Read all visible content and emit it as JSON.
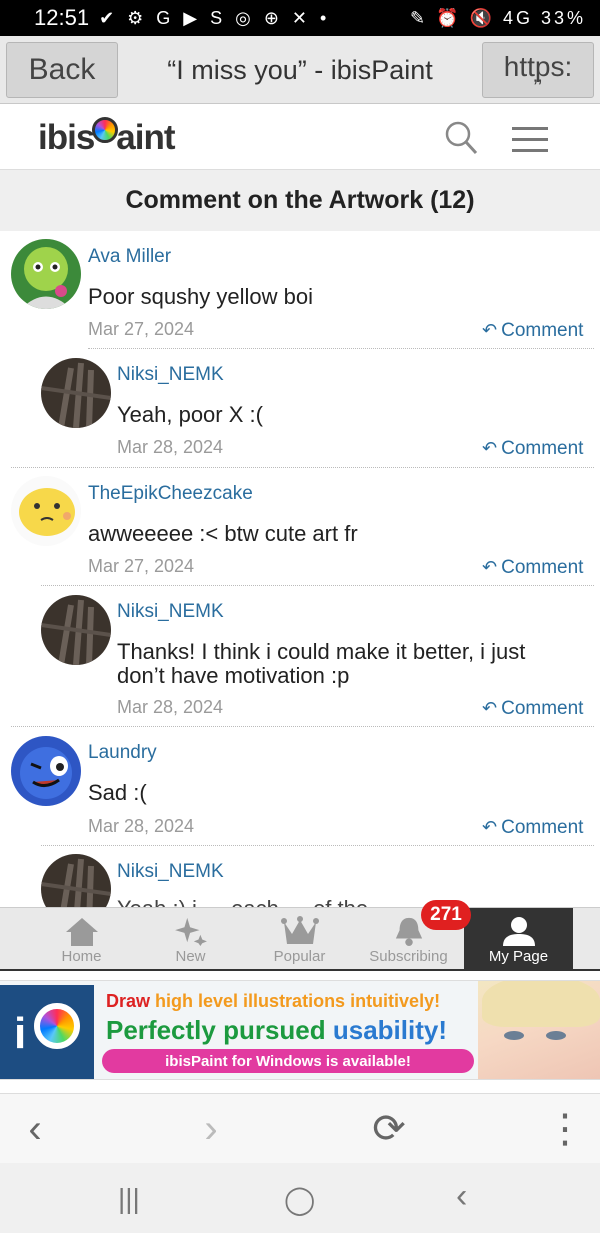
{
  "status_bar": {
    "time": "12:51",
    "icons": "✔ ⚙ G ▶ S ◎ ⊕ ✕ •",
    "right": "✎ ⏰ 🔇 4G 33%"
  },
  "toolbar": {
    "back_label": "Back",
    "title": "“I miss you” - ibisPaint",
    "https_label": "https:",
    "https_quote": "’’"
  },
  "site": {
    "logo_left": "ibis",
    "logo_right": "aint"
  },
  "section_title": "Comment on the Artwork (12)",
  "reply_label": "Comment",
  "comments": [
    {
      "name": "Ava Miller",
      "text": "Poor squshy yellow boi",
      "date": "Mar 27, 2024"
    },
    {
      "name": "Niksi_NEMK",
      "text": "Yeah, poor X :(",
      "date": "Mar 28, 2024"
    },
    {
      "name": "TheEpikCheezcake",
      "text": "awweeeee :< btw cute art fr",
      "date": "Mar 27, 2024"
    },
    {
      "name": "Niksi_NEMK",
      "text": "Thanks! I think i could make it better, i just don’t have motivation :p",
      "date": "Mar 28, 2024"
    },
    {
      "name": "Laundry",
      "text": "Sad :(",
      "date": "Mar 28, 2024"
    },
    {
      "name": "Niksi_NEMK",
      "text": "Yeah :) i … each … of the …",
      "date": ""
    }
  ],
  "app_nav": {
    "items": [
      {
        "label": "Home",
        "icon": "home-icon"
      },
      {
        "label": "New",
        "icon": "sparkle-icon"
      },
      {
        "label": "Popular",
        "icon": "crown-icon"
      },
      {
        "label": "Subscribing",
        "icon": "bell-icon"
      },
      {
        "label": "My Page",
        "icon": "person-icon"
      }
    ],
    "badge": "271"
  },
  "ad": {
    "line1_a": "Draw ",
    "line1_b": "high level illustrations intuitively!",
    "line2_a": "Perfectly pursued ",
    "line2_b": "usability!",
    "pill": "ibisPaint for Windows is available!"
  },
  "browser_bar": {
    "back": "‹",
    "forward": "›",
    "refresh": "⟳",
    "more": "⋮"
  },
  "system_nav": {
    "recents": "|||",
    "home": "◯",
    "back": "‹"
  }
}
